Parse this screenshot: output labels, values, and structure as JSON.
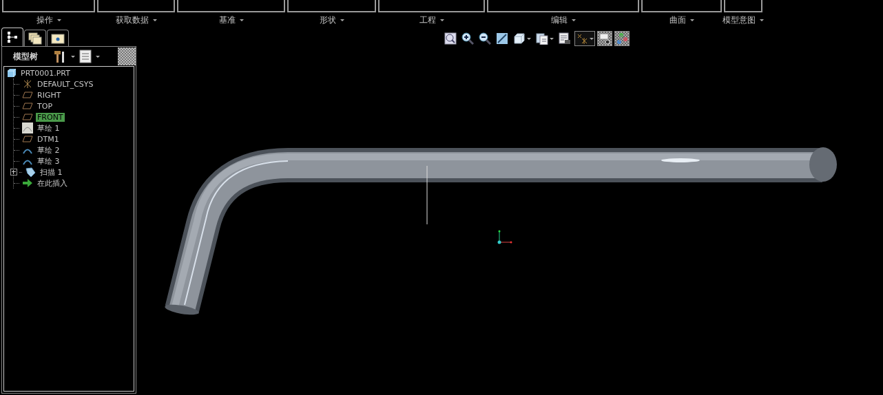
{
  "ribbon": {
    "groups": [
      {
        "label": "操作"
      },
      {
        "label": "获取数据"
      },
      {
        "label": "基准"
      },
      {
        "label": "形状"
      },
      {
        "label": "工程"
      },
      {
        "label": "编辑"
      },
      {
        "label": "曲面"
      },
      {
        "label": "模型意图"
      }
    ]
  },
  "navigator_tabs": [
    {
      "kind": "tree",
      "selected": true
    },
    {
      "kind": "folders",
      "selected": false
    },
    {
      "kind": "favorites",
      "selected": false
    }
  ],
  "model_tree": {
    "title": "模型树",
    "root": {
      "label": "PRT0001.PRT",
      "children": [
        {
          "label": "DEFAULT_CSYS",
          "kind": "csys",
          "selected": false,
          "expandable": false
        },
        {
          "label": "RIGHT",
          "kind": "plane",
          "selected": false,
          "expandable": false
        },
        {
          "label": "TOP",
          "kind": "plane",
          "selected": false,
          "expandable": false
        },
        {
          "label": "FRONT",
          "kind": "plane",
          "selected": true,
          "expandable": false
        },
        {
          "label": "草绘 1",
          "kind": "sketch",
          "selected": false,
          "expandable": false
        },
        {
          "label": "DTM1",
          "kind": "plane",
          "selected": false,
          "expandable": false
        },
        {
          "label": "草绘 2",
          "kind": "curve",
          "selected": false,
          "expandable": false
        },
        {
          "label": "草绘 3",
          "kind": "curve",
          "selected": false,
          "expandable": false
        },
        {
          "label": "扫描 1",
          "kind": "sweep",
          "selected": false,
          "expandable": true
        },
        {
          "label": "在此插入",
          "kind": "insert",
          "selected": false,
          "expandable": false
        }
      ]
    }
  },
  "view_toolbar": [
    {
      "kind": "zoom-fit",
      "dropdown": false,
      "pressed": false
    },
    {
      "kind": "zoom-in",
      "dropdown": false,
      "pressed": false
    },
    {
      "kind": "zoom-out",
      "dropdown": false,
      "pressed": false
    },
    {
      "kind": "repaint",
      "dropdown": false,
      "pressed": false
    },
    {
      "kind": "orientation",
      "dropdown": true,
      "pressed": false
    },
    {
      "kind": "saved-views",
      "dropdown": true,
      "pressed": false
    },
    {
      "kind": "view-manager",
      "dropdown": false,
      "pressed": false
    },
    {
      "kind": "datum-display",
      "dropdown": true,
      "pressed": true
    },
    {
      "kind": "annotation-display",
      "dropdown": false,
      "pressed": true
    },
    {
      "kind": "spin-center",
      "dropdown": false,
      "pressed": true
    }
  ]
}
